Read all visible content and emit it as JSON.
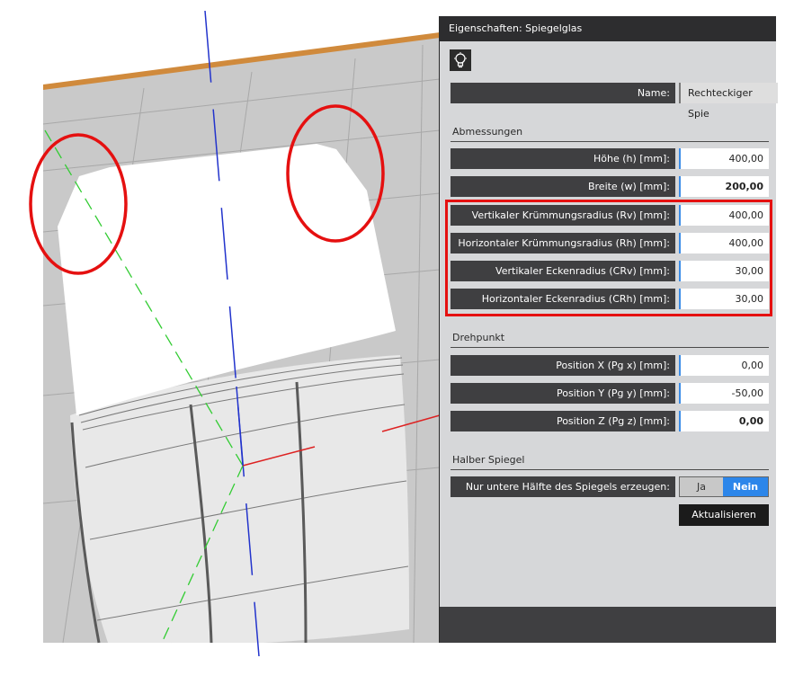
{
  "panel": {
    "title": "Eigenschaften: Spiegelglas",
    "name_label": "Name:",
    "name_value": "Rechteckiger Spie",
    "sections": {
      "dimensions": "Abmessungen",
      "pivot": "Drehpunkt",
      "half_mirror": "Halber Spiegel"
    },
    "dimensions": [
      {
        "label": "Höhe (h) [mm]:",
        "value": "400,00"
      },
      {
        "label": "Breite (w) [mm]:",
        "value": "200,00"
      },
      {
        "label": "Vertikaler Krümmungsradius (Rv) [mm]:",
        "value": "400,00"
      },
      {
        "label": "Horizontaler Krümmungsradius (Rh) [mm]:",
        "value": "400,00"
      },
      {
        "label": "Vertikaler Eckenradius (CRv) [mm]:",
        "value": "30,00"
      },
      {
        "label": "Horizontaler Eckenradius (CRh) [mm]:",
        "value": "30,00"
      }
    ],
    "pivot": [
      {
        "label": "Position X (Pg x) [mm]:",
        "value": "0,00"
      },
      {
        "label": "Position Y (Pg y) [mm]:",
        "value": "-50,00"
      },
      {
        "label": "Position Z (Pg z) [mm]:",
        "value": "0,00"
      }
    ],
    "half_mirror": {
      "label": "Nur untere Hälfte des Spiegels erzeugen:",
      "option_yes": "Ja",
      "option_no": "Nein",
      "selected": "Nein"
    },
    "update_button": "Aktualisieren",
    "icon": "lightbulb-icon"
  },
  "colors": {
    "accent": "#2c86ea",
    "highlight": "#e51010",
    "panel_bg": "#d6d7d9",
    "label_bg": "#3f3f41"
  }
}
